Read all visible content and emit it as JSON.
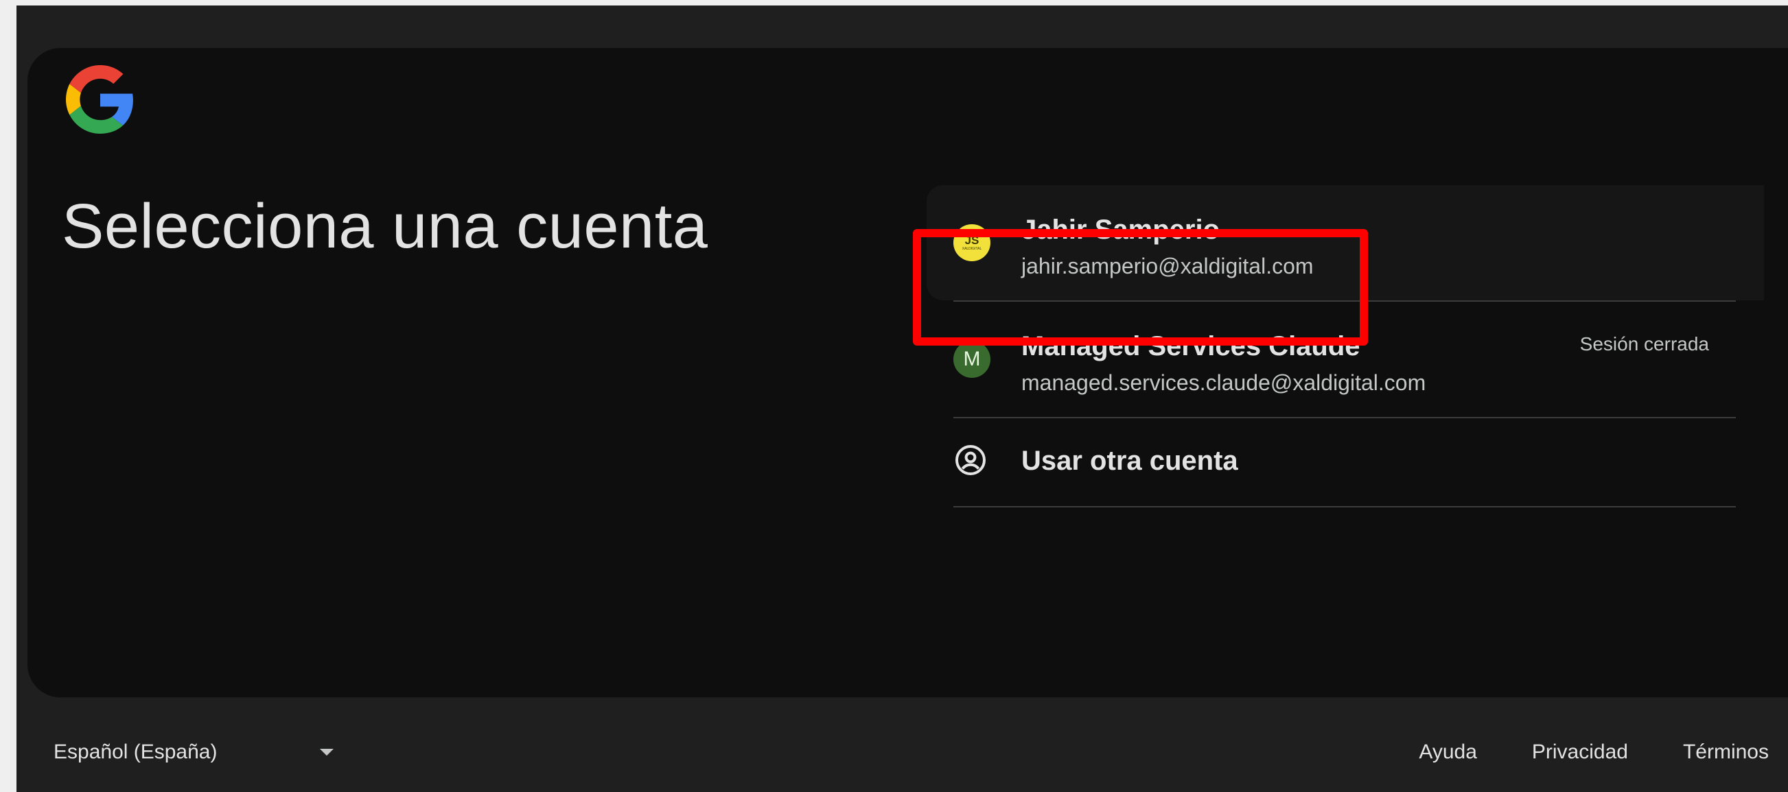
{
  "page": {
    "title": "Selecciona una cuenta"
  },
  "brand": {
    "logo_icon": "google-g-icon",
    "colors": {
      "blue": "#4285F4",
      "red": "#EA4335",
      "yellow": "#FBBC05",
      "green": "#34A853"
    }
  },
  "accounts": [
    {
      "name": "Jahir Samperio",
      "email": "jahir.samperio@xaldigital.com",
      "avatar_text": "JS",
      "avatar_subtext": "XALDIGITAL",
      "avatar_color": "#f2e13a",
      "status": "",
      "highlighted": true
    },
    {
      "name": "Managed Services Claude",
      "email": "managed.services.claude@xaldigital.com",
      "avatar_text": "M",
      "avatar_color": "#3a6b2e",
      "status": "Sesión cerrada"
    }
  ],
  "other_account": {
    "label": "Usar otra cuenta",
    "icon": "account-circle-icon"
  },
  "footer": {
    "language": "Español (España)",
    "links": [
      "Ayuda",
      "Privacidad",
      "Términos"
    ]
  },
  "annotation": {
    "highlight_color": "#ff0000"
  }
}
